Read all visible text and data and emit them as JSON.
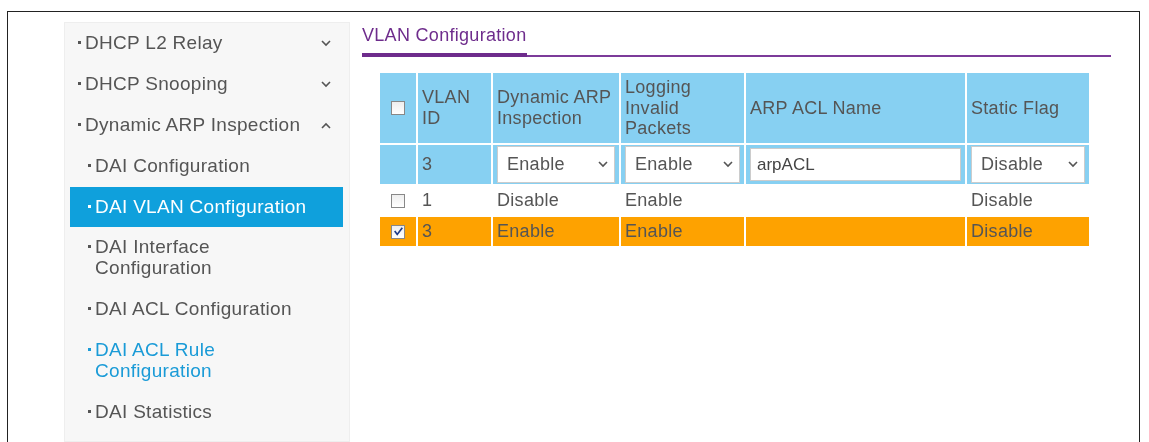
{
  "sidebar": {
    "items": [
      {
        "label": "DHCP L2 Relay",
        "expanded": false
      },
      {
        "label": "DHCP Snooping",
        "expanded": false
      },
      {
        "label": "Dynamic ARP Inspection",
        "expanded": true,
        "children": [
          {
            "label": "DAI Configuration",
            "selected": false,
            "hovered": false
          },
          {
            "label": "DAI VLAN Configuration",
            "selected": true,
            "hovered": false
          },
          {
            "label": "DAI Interface Configuration",
            "selected": false,
            "hovered": false
          },
          {
            "label": "DAI ACL Configuration",
            "selected": false,
            "hovered": false
          },
          {
            "label": "DAI ACL Rule Configuration",
            "selected": false,
            "hovered": true
          },
          {
            "label": "DAI Statistics",
            "selected": false,
            "hovered": false
          }
        ]
      }
    ]
  },
  "section_title": "VLAN Configuration",
  "table": {
    "select_all_checked": false,
    "columns": [
      "VLAN ID",
      "Dynamic ARP Inspection",
      "Logging Invalid Packets",
      "ARP ACL Name",
      "Static Flag"
    ],
    "edit_row": {
      "vlan_id": "3",
      "dynamic_arp_inspection": "Enable",
      "logging_invalid_packets": "Enable",
      "arp_acl_name": "arpACL",
      "static_flag": "Disable"
    },
    "rows": [
      {
        "checked": false,
        "selected": false,
        "vlan_id": "1",
        "dynamic_arp_inspection": "Disable",
        "logging_invalid_packets": "Enable",
        "static_flag": "Disable"
      },
      {
        "checked": true,
        "selected": true,
        "vlan_id": "3",
        "dynamic_arp_inspection": "Enable",
        "logging_invalid_packets": "Enable",
        "static_flag": "Disable"
      }
    ]
  }
}
